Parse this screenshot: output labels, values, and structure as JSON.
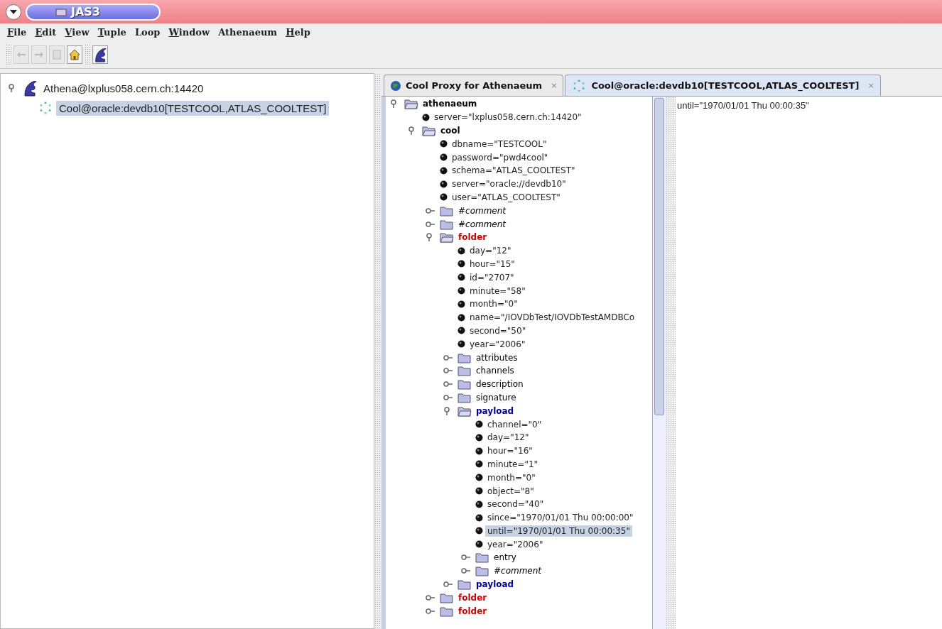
{
  "window": {
    "title": "JAS3"
  },
  "menu": [
    {
      "label": "File",
      "underline_first": true
    },
    {
      "label": "Edit",
      "underline_first": true
    },
    {
      "label": "View",
      "underline_first": true
    },
    {
      "label": "Tuple",
      "underline_first": true
    },
    {
      "label": "Loop",
      "underline_first": false
    },
    {
      "label": "Window",
      "underline_first": true
    },
    {
      "label": "Athenaeum",
      "underline_first": false
    },
    {
      "label": "Help",
      "underline_first": true
    }
  ],
  "toolbar": [
    [
      {
        "kind": "back",
        "disabled": true
      },
      {
        "kind": "forward",
        "disabled": true
      },
      {
        "kind": "page",
        "disabled": true
      },
      {
        "kind": "home",
        "disabled": false
      }
    ],
    [
      {
        "kind": "athena",
        "disabled": false
      }
    ]
  ],
  "left_tree": [
    {
      "label": "Athena@lxplus058.cern.ch:14420",
      "kind": "athena",
      "expanded": true,
      "selected": false,
      "children": [
        {
          "label": "Cool@oracle:devdb10[TESTCOOL,ATLAS_COOLTEST]",
          "kind": "cool",
          "selected": true
        }
      ]
    }
  ],
  "tabs": [
    {
      "label": "Cool Proxy for Athenaeum",
      "kind": "globe",
      "close": "×",
      "selected": false
    },
    {
      "label": "Cool@oracle:devdb10[TESTCOOL,ATLAS_COOLTEST]",
      "kind": "cool",
      "close": "×",
      "selected": true
    }
  ],
  "xml_tree": [
    {
      "kind": "folder",
      "label": "athenaeum",
      "bold": true,
      "italic": false,
      "color": "#000000",
      "expanded": true,
      "selected": false,
      "children": [
        {
          "kind": "attribute",
          "label": "server=\"lxplus058.cern.ch:14420\"",
          "selected": false
        },
        {
          "kind": "folder",
          "label": "cool",
          "bold": true,
          "italic": false,
          "color": "#000000",
          "expanded": true,
          "selected": false,
          "children": [
            {
              "kind": "attribute",
              "label": "dbname=\"TESTCOOL\"",
              "selected": false
            },
            {
              "kind": "attribute",
              "label": "password=\"pwd4cool\"",
              "selected": false
            },
            {
              "kind": "attribute",
              "label": "schema=\"ATLAS_COOLTEST\"",
              "selected": false
            },
            {
              "kind": "attribute",
              "label": "server=\"oracle://devdb10\"",
              "selected": false
            },
            {
              "kind": "attribute",
              "label": "user=\"ATLAS_COOLTEST\"",
              "selected": false
            },
            {
              "kind": "folder",
              "label": "#comment",
              "bold": false,
              "italic": true,
              "color": "#000000",
              "expanded": false,
              "selected": false
            },
            {
              "kind": "folder",
              "label": "#comment",
              "bold": false,
              "italic": true,
              "color": "#000000",
              "expanded": false,
              "selected": false
            },
            {
              "kind": "folder",
              "label": "folder",
              "bold": true,
              "italic": false,
              "color": "#cc0000",
              "expanded": true,
              "selected": false,
              "children": [
                {
                  "kind": "attribute",
                  "label": "day=\"12\"",
                  "selected": false
                },
                {
                  "kind": "attribute",
                  "label": "hour=\"15\"",
                  "selected": false
                },
                {
                  "kind": "attribute",
                  "label": "id=\"2707\"",
                  "selected": false
                },
                {
                  "kind": "attribute",
                  "label": "minute=\"58\"",
                  "selected": false
                },
                {
                  "kind": "attribute",
                  "label": "month=\"0\"",
                  "selected": false
                },
                {
                  "kind": "attribute",
                  "label": "name=\"/IOVDbTest/IOVDbTestAMDBCo",
                  "selected": false
                },
                {
                  "kind": "attribute",
                  "label": "second=\"50\"",
                  "selected": false
                },
                {
                  "kind": "attribute",
                  "label": "year=\"2006\"",
                  "selected": false
                },
                {
                  "kind": "folder",
                  "label": "attributes",
                  "bold": false,
                  "italic": false,
                  "color": "#000000",
                  "expanded": false,
                  "selected": false
                },
                {
                  "kind": "folder",
                  "label": "channels",
                  "bold": false,
                  "italic": false,
                  "color": "#000000",
                  "expanded": false,
                  "selected": false
                },
                {
                  "kind": "folder",
                  "label": "description",
                  "bold": false,
                  "italic": false,
                  "color": "#000000",
                  "expanded": false,
                  "selected": false
                },
                {
                  "kind": "folder",
                  "label": "signature",
                  "bold": false,
                  "italic": false,
                  "color": "#000000",
                  "expanded": false,
                  "selected": false
                },
                {
                  "kind": "folder",
                  "label": "payload",
                  "bold": true,
                  "italic": false,
                  "color": "#000099",
                  "expanded": true,
                  "selected": false,
                  "children": [
                    {
                      "kind": "attribute",
                      "label": "channel=\"0\"",
                      "selected": false
                    },
                    {
                      "kind": "attribute",
                      "label": "day=\"12\"",
                      "selected": false
                    },
                    {
                      "kind": "attribute",
                      "label": "hour=\"16\"",
                      "selected": false
                    },
                    {
                      "kind": "attribute",
                      "label": "minute=\"1\"",
                      "selected": false
                    },
                    {
                      "kind": "attribute",
                      "label": "month=\"0\"",
                      "selected": false
                    },
                    {
                      "kind": "attribute",
                      "label": "object=\"8\"",
                      "selected": false
                    },
                    {
                      "kind": "attribute",
                      "label": "second=\"40\"",
                      "selected": false
                    },
                    {
                      "kind": "attribute",
                      "label": "since=\"1970/01/01 Thu 00:00:00\"",
                      "selected": false
                    },
                    {
                      "kind": "attribute",
                      "label": "until=\"1970/01/01 Thu 00:00:35\"",
                      "selected": true
                    },
                    {
                      "kind": "attribute",
                      "label": "year=\"2006\"",
                      "selected": false
                    },
                    {
                      "kind": "folder",
                      "label": "entry",
                      "bold": false,
                      "italic": false,
                      "color": "#000000",
                      "expanded": false,
                      "selected": false
                    },
                    {
                      "kind": "folder",
                      "label": "#comment",
                      "bold": false,
                      "italic": true,
                      "color": "#000000",
                      "expanded": false,
                      "selected": false
                    }
                  ]
                },
                {
                  "kind": "folder",
                  "label": "payload",
                  "bold": true,
                  "italic": false,
                  "color": "#000099",
                  "expanded": false,
                  "selected": false
                }
              ]
            },
            {
              "kind": "folder",
              "label": "folder",
              "bold": true,
              "italic": false,
              "color": "#cc0000",
              "expanded": false,
              "selected": false
            },
            {
              "kind": "folder",
              "label": "folder",
              "bold": true,
              "italic": false,
              "color": "#cc0000",
              "expanded": false,
              "selected": false
            }
          ]
        }
      ]
    }
  ],
  "detail": {
    "text": "until=\"1970/01/01 Thu 00:00:35\""
  }
}
